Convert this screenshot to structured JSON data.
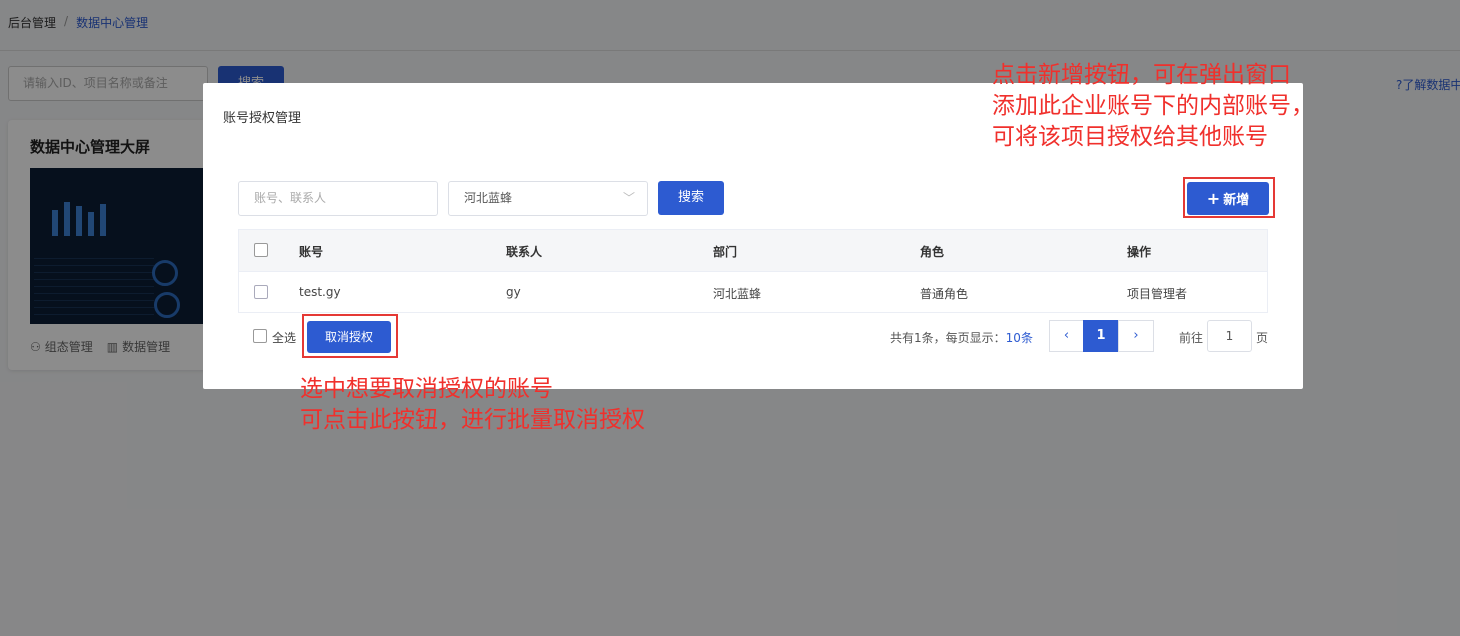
{
  "background": {
    "breadcrumb": {
      "root": "后台管理",
      "separator": "/",
      "current": "数据中心管理"
    },
    "search": {
      "placeholder": "请输入ID、项目名称或备注",
      "button": "搜索"
    },
    "help_link": "?了解数据中",
    "card": {
      "title": "数据中心管理大屏",
      "links": [
        {
          "label": "组态管理",
          "icon": "org-chart-icon"
        },
        {
          "label": "数据管理",
          "icon": "bar-chart-icon"
        }
      ]
    }
  },
  "dialog": {
    "title": "账号授权管理",
    "account_placeholder": "账号、联系人",
    "department_value": "河北蓝蜂",
    "search_button": "搜索",
    "add_button": "新增",
    "table": {
      "headers": [
        "账号",
        "联系人",
        "部门",
        "角色",
        "操作"
      ],
      "rows": [
        {
          "account": "test.gy",
          "contact": "gy",
          "department": "河北蓝蜂",
          "role": "普通角色",
          "action": "项目管理者"
        }
      ]
    },
    "select_all_label": "全选",
    "cancel_button": "取消授权",
    "pagination": {
      "total_prefix": "共有",
      "total": "1",
      "total_mid": "条，每页显示：",
      "page_size": "10条",
      "current_page": "1",
      "goto_label": "前往",
      "goto_value": "1",
      "goto_unit": "页"
    }
  },
  "annotations": {
    "add_note": [
      "点击新增按钮，可在弹出窗口",
      "添加此企业账号下的内部账号，",
      "可将该项目授权给其他账号"
    ],
    "cancel_note": [
      "选中想要取消授权的账号",
      "可点击此按钮，进行批量取消授权"
    ]
  },
  "colors": {
    "primary": "#2d5bd1",
    "annotation": "#f0302c"
  }
}
